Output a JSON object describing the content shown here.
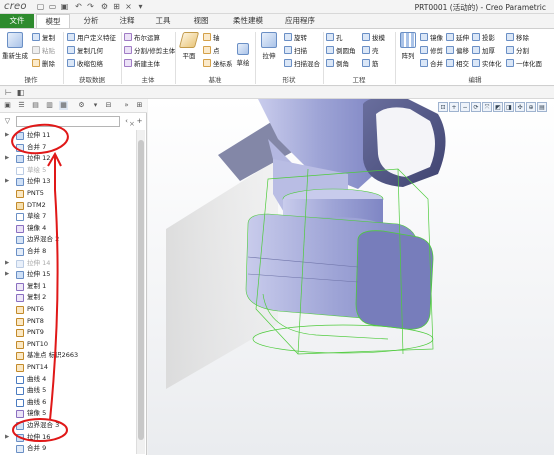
{
  "app": {
    "logo": "creo",
    "window_title": "PRT0001 (活动的) - Creo Parametric"
  },
  "tabs": [
    "文件",
    "模型",
    "分析",
    "注释",
    "工具",
    "视图",
    "柔性建模",
    "应用程序"
  ],
  "ribbon": {
    "operations": {
      "group_label": "操作",
      "regen": "重新生成",
      "copy": "复制",
      "paste": "粘贴",
      "delete": "删除"
    },
    "get_data": {
      "group_label": "获取数据",
      "udf": "用户定义特征",
      "copy_geom": "复制几何",
      "shrinkwrap": "收缩包络"
    },
    "body": {
      "group_label": "主体",
      "boolean": "布尔运算",
      "split": "分割/修剪主体",
      "new_body": "新建主体"
    },
    "datum": {
      "group_label": "基准",
      "plane": "平面",
      "axis": "轴",
      "point": "点",
      "csys": "坐标系",
      "sketch": "草绘"
    },
    "shapes": {
      "group_label": "形状",
      "extrude": "拉伸",
      "revolve": "旋转",
      "sweep": "扫描",
      "swept_blend": "扫描混合"
    },
    "engineering": {
      "group_label": "工程",
      "hole": "孔",
      "round": "倒圆角",
      "chamfer": "倒角",
      "draft": "拔模",
      "shell": "壳",
      "rib": "筋"
    },
    "editing": {
      "group_label": "编辑",
      "pattern": "阵列",
      "mirror": "镜像",
      "extend": "延伸",
      "project": "投影",
      "remove": "移除",
      "trim": "修剪",
      "offset": "偏移",
      "thicken": "加厚",
      "split": "分割",
      "merge": "合并",
      "intersect": "相交",
      "solidify": "实体化",
      "unify": "一体化面"
    }
  },
  "model_tree": {
    "items": [
      {
        "label": "拉伸 11",
        "icon": "extrude-icon",
        "expand": true
      },
      {
        "label": "合并 7",
        "icon": "merge-icon",
        "expand": false
      },
      {
        "label": "拉伸 12",
        "icon": "extrude-icon",
        "expand": true
      },
      {
        "label": "草绘 5",
        "icon": "sketch-icon",
        "expand": false,
        "dim": true
      },
      {
        "label": "拉伸 13",
        "icon": "extrude-icon",
        "expand": true
      },
      {
        "label": "PNT5",
        "icon": "datum-point-icon",
        "expand": false
      },
      {
        "label": "DTM2",
        "icon": "datum-plane-icon",
        "expand": false
      },
      {
        "label": "草绘 7",
        "icon": "sketch-icon",
        "expand": false
      },
      {
        "label": "镜像 4",
        "icon": "mirror-icon",
        "expand": false
      },
      {
        "label": "边界混合 2",
        "icon": "boundary-blend-icon",
        "expand": false
      },
      {
        "label": "合并 8",
        "icon": "merge-icon",
        "expand": false
      },
      {
        "label": "拉伸 14",
        "icon": "extrude-icon",
        "expand": true,
        "dim": true
      },
      {
        "label": "拉伸 15",
        "icon": "extrude-icon",
        "expand": true
      },
      {
        "label": "复制 1",
        "icon": "copy-icon",
        "expand": false
      },
      {
        "label": "复制 2",
        "icon": "copy-icon",
        "expand": false
      },
      {
        "label": "PNT6",
        "icon": "datum-point-icon",
        "expand": false
      },
      {
        "label": "PNT8",
        "icon": "datum-point-icon",
        "expand": false
      },
      {
        "label": "PNT9",
        "icon": "datum-point-icon",
        "expand": false
      },
      {
        "label": "PNT10",
        "icon": "datum-point-icon",
        "expand": false
      },
      {
        "label": "基准点 标识2663",
        "icon": "datum-point-icon",
        "expand": false
      },
      {
        "label": "PNT14",
        "icon": "datum-point-icon",
        "expand": false
      },
      {
        "label": "曲线 4",
        "icon": "curve-icon",
        "expand": false
      },
      {
        "label": "曲线 5",
        "icon": "curve-icon",
        "expand": false
      },
      {
        "label": "曲线 6",
        "icon": "curve-icon",
        "expand": false
      },
      {
        "label": "镜像 5",
        "icon": "mirror-icon",
        "expand": false
      },
      {
        "label": "边界混合 3",
        "icon": "boundary-blend-icon",
        "expand": false
      },
      {
        "label": "拉伸 16",
        "icon": "extrude-icon",
        "expand": true
      },
      {
        "label": "合并 9",
        "icon": "merge-icon",
        "expand": false
      }
    ]
  },
  "colors": {
    "file_tab": "#2e8b2e",
    "annotation": "#e01818",
    "model_surface": "#9ea4d6",
    "wireframe": "#4ecb3c"
  }
}
